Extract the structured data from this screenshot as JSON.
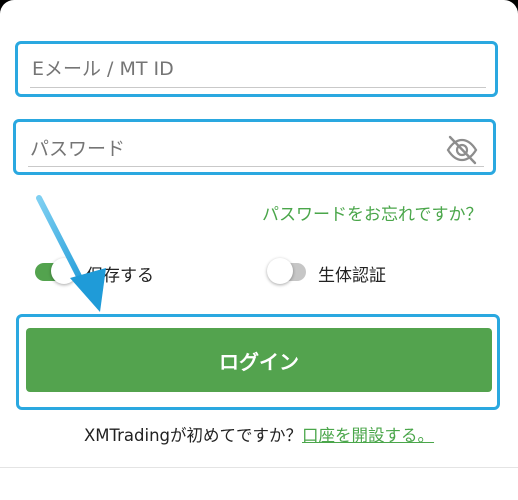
{
  "login_form": {
    "email_placeholder": "Eメール / MT ID",
    "password_placeholder": "パスワード",
    "forgot_password_link": "パスワードをお忘れですか？",
    "remember_toggle": {
      "label": "保存する",
      "on": true
    },
    "biometric_toggle": {
      "label": "生体認証",
      "on": false
    },
    "login_button": "ログイン",
    "signup_prompt": "XMTradingが初めてですか？",
    "signup_link": "口座を開設する。"
  },
  "icons": {
    "password_visibility": "eye-off-icon",
    "annotation_arrow": "arrow-icon"
  },
  "colors": {
    "accent_green": "#53a34e",
    "link_green": "#4aa64a",
    "highlight_blue": "#2aa8e0"
  }
}
